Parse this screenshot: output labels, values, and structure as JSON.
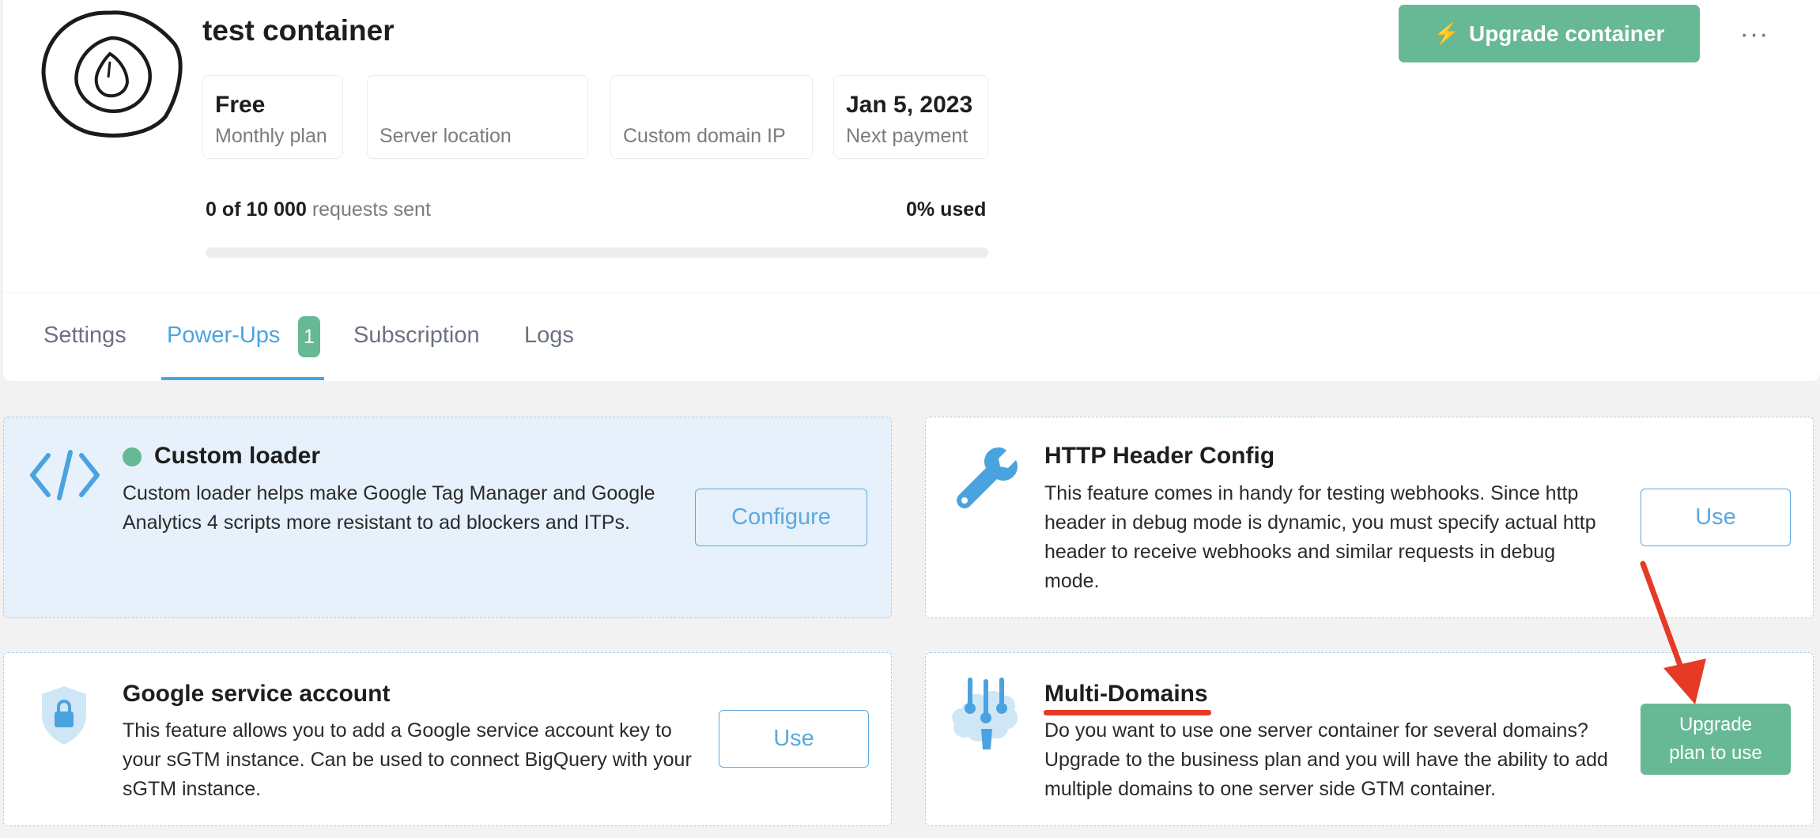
{
  "container": {
    "title": "test container",
    "info": [
      {
        "value": "Free",
        "label": "Monthly plan"
      },
      {
        "value": "",
        "label": "Server location"
      },
      {
        "value": "",
        "label": "Custom domain IP"
      },
      {
        "value": "Jan 5, 2023",
        "label": "Next payment"
      }
    ],
    "usage": {
      "count_text": "0 of 10 000",
      "suffix_text": "requests sent",
      "percent_text": "0% used",
      "fraction_used": 0
    },
    "upgrade_button_label": "Upgrade container",
    "more_label": "···"
  },
  "tabs": [
    {
      "label": "Settings"
    },
    {
      "label": "Power-Ups",
      "badge": "1"
    },
    {
      "label": "Subscription"
    },
    {
      "label": "Logs"
    }
  ],
  "powerups": {
    "custom_loader": {
      "title": "Custom loader",
      "description": "Custom loader helps make Google Tag Manager and Google Analytics 4 scripts more resistant to ad blockers and ITPs.",
      "button_label": "Configure",
      "icon": "code-icon"
    },
    "http_header": {
      "title": "HTTP Header Config",
      "description": "This feature comes in handy for testing webhooks. Since http header in debug mode is dynamic, you must specify actual http header to receive webhooks and similar requests in debug mode.",
      "button_label": "Use",
      "icon": "wrench-icon"
    },
    "google_service": {
      "title": "Google service account",
      "description": "This feature allows you to add a Google service account key to your sGTM instance. Can be used to connect BigQuery with your sGTM instance.",
      "button_label": "Use",
      "icon": "shield-lock-icon"
    },
    "multi_domains": {
      "title": "Multi-Domains",
      "description": "Do you want to use one server container for several domains? Upgrade to the business plan and you will have the ability to add multiple domains to one server side GTM container.",
      "button_label_line1": "Upgrade",
      "button_label_line2": "plan to use",
      "icon": "brain-network-icon"
    }
  },
  "colors": {
    "accent_green": "#67b895",
    "accent_blue": "#4aa3df",
    "annotation_red": "#e53b26"
  }
}
